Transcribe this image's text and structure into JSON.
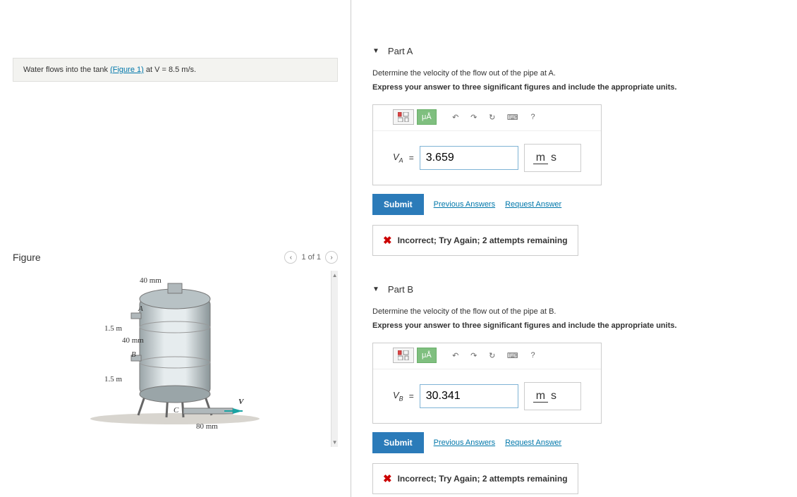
{
  "problem": {
    "prefix": "Water flows into the tank ",
    "figure_link": "(Figure 1)",
    "suffix": " at V = 8.5 m/s."
  },
  "figure": {
    "title": "Figure",
    "nav_text": "1 of 1",
    "labels": {
      "top_pipe": "40 mm",
      "A": "A",
      "height_upper": "1.5 m",
      "mid_pipe": "40 mm",
      "B": "B",
      "height_lower": "1.5 m",
      "C": "C",
      "V": "V",
      "bottom_pipe": "80 mm"
    }
  },
  "parts": {
    "A": {
      "title": "Part A",
      "question": "Determine the velocity of the flow out of the pipe at A.",
      "instruction": "Express your answer to three significant figures and include the appropriate units.",
      "var_label": "V",
      "var_sub": "A",
      "equals": "=",
      "value": "3.659",
      "unit_top": "m",
      "unit_bot": "s",
      "submit": "Submit",
      "prev_answers": "Previous Answers",
      "request_answer": "Request Answer",
      "feedback": "Incorrect; Try Again; 2 attempts remaining"
    },
    "B": {
      "title": "Part B",
      "question": "Determine the velocity of the flow out of the pipe at B.",
      "instruction": "Express your answer to three significant figures and include the appropriate units.",
      "var_label": "V",
      "var_sub": "B",
      "equals": "=",
      "value": "30.341",
      "unit_top": "m",
      "unit_bot": "s",
      "submit": "Submit",
      "prev_answers": "Previous Answers",
      "request_answer": "Request Answer",
      "feedback": "Incorrect; Try Again; 2 attempts remaining"
    }
  },
  "toolbar": {
    "micro": "μÅ",
    "undo": "↶",
    "redo": "↷",
    "reset": "↻",
    "keyboard": "⌨",
    "help": "?"
  }
}
